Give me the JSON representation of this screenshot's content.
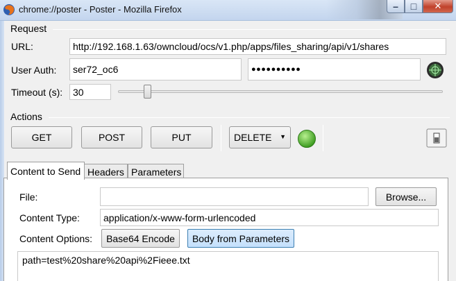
{
  "window": {
    "title": "chrome://poster - Poster - Mozilla Firefox",
    "minimize": "–",
    "maximize": "□",
    "close": "✕"
  },
  "request": {
    "section_title": "Request",
    "url_label": "URL:",
    "url_value": "http://192.168.1.63/owncloud/ocs/v1.php/apps/files_sharing/api/v1/shares",
    "auth_label": "User Auth:",
    "auth_user": "ser72_oc6",
    "auth_password": "●●●●●●●●●●",
    "timeout_label": "Timeout (s):",
    "timeout_value": "30"
  },
  "actions": {
    "section_title": "Actions",
    "get": "GET",
    "post": "POST",
    "put": "PUT",
    "method_selected": "DELETE",
    "status_color": "#49b52c"
  },
  "tabs": [
    "Content to Send",
    "Headers",
    "Parameters"
  ],
  "content": {
    "file_label": "File:",
    "file_value": "",
    "browse": "Browse...",
    "content_type_label": "Content Type:",
    "content_type_value": "application/x-www-form-urlencoded",
    "options_label": "Content Options:",
    "base64": "Base64 Encode",
    "body_from_params": "Body from Parameters",
    "body_text": "path=test%20share%20api%2Fieee.txt"
  }
}
